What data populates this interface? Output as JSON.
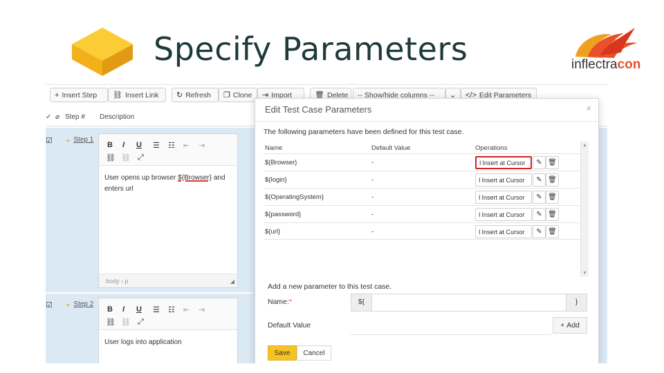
{
  "slide": {
    "title": "Specify Parameters",
    "logo_text_a": "inflectra",
    "logo_text_b": "con"
  },
  "toolbar": {
    "insert_step": "Insert Step",
    "insert_link": "Insert Link",
    "refresh": "Refresh",
    "clone": "Clone",
    "import": "Import",
    "delete": "Delete",
    "show_hide": "-- Show/hide columns --",
    "edit_parameters": "Edit Parameters"
  },
  "grid": {
    "col_step": "Step #",
    "col_description": "Description",
    "steps": [
      {
        "label": "Step 1",
        "text_before": "User opens up browser ",
        "param": "${Browser}",
        "text_after": " and enters url",
        "status_body": "body",
        "status_p": "p"
      },
      {
        "label": "Step 2",
        "text": "User logs into application"
      }
    ]
  },
  "modal": {
    "title": "Edit Test Case Parameters",
    "close": "×",
    "intro": "The following parameters have been defined for this test case.",
    "headers": {
      "name": "Name",
      "default": "Default Value",
      "operations": "Operations"
    },
    "insert_label": "Insert at Cursor",
    "params": [
      {
        "name": "${Browser}",
        "default": "-"
      },
      {
        "name": "${login}",
        "default": "-"
      },
      {
        "name": "${OperatingSystem}",
        "default": "-"
      },
      {
        "name": "${password}",
        "default": "-"
      },
      {
        "name": "${url}",
        "default": "-"
      }
    ],
    "add_heading": "Add a new parameter to this test case.",
    "name_label": "Name:",
    "required_mark": "*",
    "name_prefix": "${",
    "name_suffix": "}",
    "default_label": "Default Value",
    "add_button": "Add",
    "save": "Save",
    "cancel": "Cancel"
  },
  "colors": {
    "accent_yellow": "#f6c324",
    "row_blue": "#dbe9f5",
    "highlight_red": "#d42323",
    "brand_orange": "#e8512a"
  }
}
